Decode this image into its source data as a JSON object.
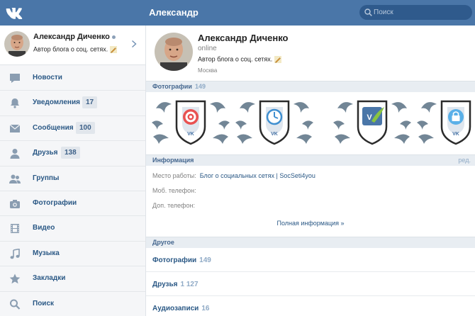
{
  "header": {
    "logo_icon": "vk-logo-icon",
    "title": "Александр",
    "search_placeholder": "Поиск",
    "color": "#4a76a8"
  },
  "sidebar": {
    "profile": {
      "name": "Александр Диченко",
      "status": "Автор блога о соц. сетях."
    },
    "items": [
      {
        "label": "Новости",
        "icon": "news-icon",
        "badge": ""
      },
      {
        "label": "Уведомления",
        "icon": "bell-icon",
        "badge": "17"
      },
      {
        "label": "Сообщения",
        "icon": "envelope-icon",
        "badge": "100"
      },
      {
        "label": "Друзья",
        "icon": "person-icon",
        "badge": "138"
      },
      {
        "label": "Группы",
        "icon": "group-icon",
        "badge": ""
      },
      {
        "label": "Фотографии",
        "icon": "camera-icon",
        "badge": ""
      },
      {
        "label": "Видео",
        "icon": "film-icon",
        "badge": ""
      },
      {
        "label": "Музыка",
        "icon": "music-note-icon",
        "badge": ""
      },
      {
        "label": "Закладки",
        "icon": "star-icon",
        "badge": ""
      },
      {
        "label": "Поиск",
        "icon": "search-icon",
        "badge": ""
      }
    ]
  },
  "main": {
    "profile": {
      "name": "Александр Диченко",
      "online": "online",
      "status": "Автор блога о соц. сетях.",
      "city": "Москва"
    },
    "photos": {
      "title": "Фотографии",
      "count": "149",
      "emblems": [
        "target-emblem",
        "clock-emblem",
        "vk-emblem",
        "lock-emblem"
      ]
    },
    "info": {
      "title": "Информация",
      "edit": "ред.",
      "work_label": "Место работы:",
      "work_value": "Блог о социальных сетях | SocSeti4you",
      "mobile_label": "Моб. телефон:",
      "extra_label": "Доп. телефон:",
      "more": "Полная информация »"
    },
    "other": {
      "title": "Другое",
      "rows": [
        {
          "label": "Фотографии",
          "count": "149"
        },
        {
          "label": "Друзья",
          "count": "1 127"
        },
        {
          "label": "Аудиозаписи",
          "count": "16"
        }
      ]
    }
  }
}
